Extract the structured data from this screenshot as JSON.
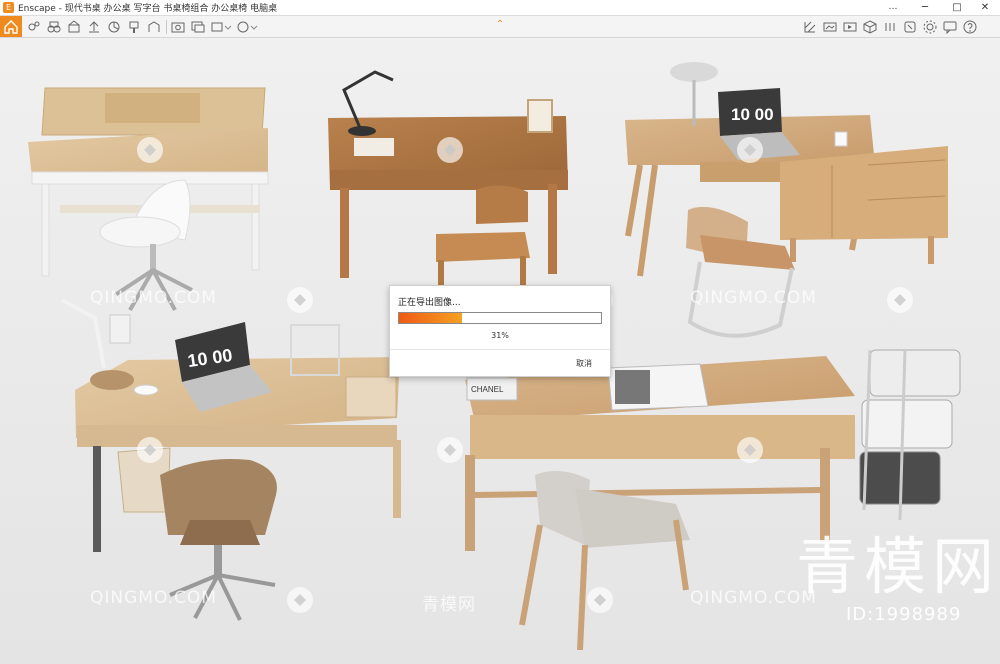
{
  "window": {
    "app_icon": "E",
    "title": "Enscape - 现代书桌 办公桌 写字台 书桌椅组合 办公桌椅 电脑桌",
    "controls": {
      "menu": "…",
      "minimize": "─",
      "maximize": "□",
      "close": "✕"
    }
  },
  "toolbar": {
    "collapse_caret": "⌃",
    "accent_color": "#ef8a1e",
    "left_icons": [
      "home-icon",
      "asset-icon",
      "binoculars-icon",
      "bim-icon",
      "upload-icon",
      "views-icon",
      "cloud-icon",
      "paint-icon",
      "settings-icon",
      "chart-icon",
      "screenshot-icon",
      "batch-icon",
      "export-icon",
      "web-icon"
    ],
    "right_icons": [
      "grid-icon",
      "panorama-icon",
      "video-icon",
      "cube-icon",
      "link-icon",
      "palette-icon",
      "gear-icon",
      "feedback-icon",
      "help-icon"
    ]
  },
  "scene": {
    "laptop_screen_1": "10 00",
    "laptop_screen_2": "10 00",
    "book_spine": "CHANEL"
  },
  "dialog": {
    "title": "正在导出图像...",
    "progress": 0.31,
    "percent_text": "31%",
    "cancel_label": "取消",
    "fill_color_start": "#f05a14",
    "fill_color_end": "#f5a123"
  },
  "watermark": {
    "brand_latin": "QINGMO.COM",
    "brand_cn": "青模网",
    "big_cn": "青模网",
    "id_text": "ID:1998989"
  }
}
